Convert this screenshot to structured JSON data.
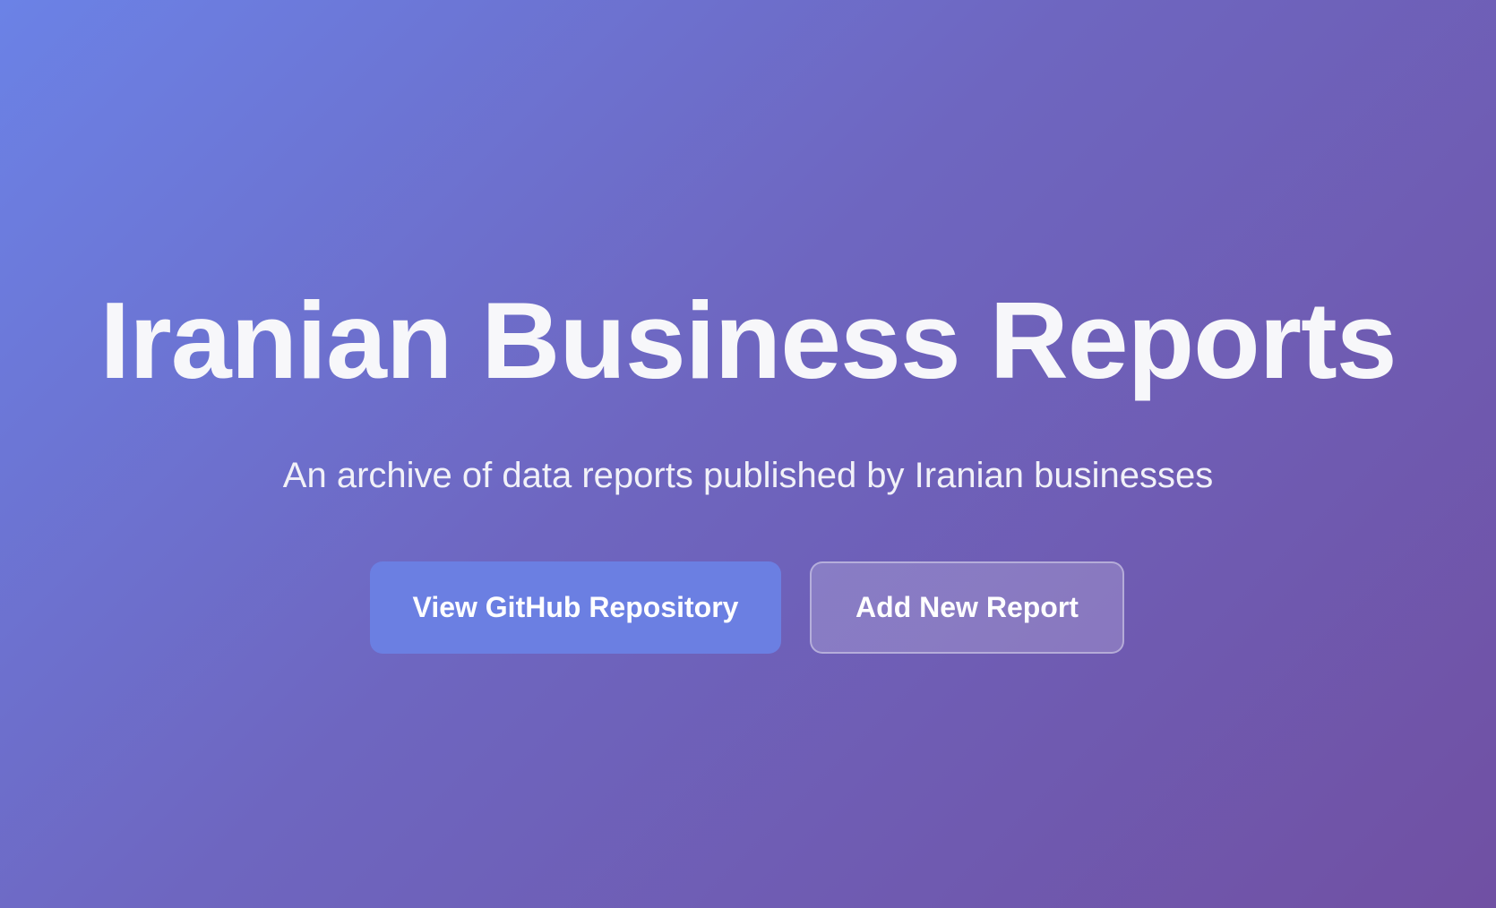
{
  "hero": {
    "title": "Iranian Business Reports",
    "subtitle": "An archive of data reports published by Iranian businesses"
  },
  "actions": {
    "github_label": "View GitHub Repository",
    "add_report_label": "Add New Report"
  },
  "colors": {
    "gradient_start": "#6b82e6",
    "gradient_end": "#7050a3",
    "primary_button": "#6b7fe2",
    "text": "#ffffff"
  }
}
